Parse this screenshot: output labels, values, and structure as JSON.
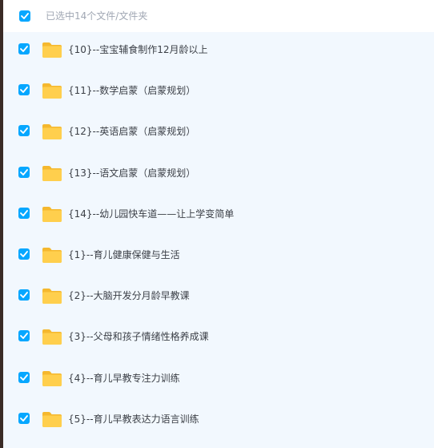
{
  "header": {
    "selection_text": "已选中14个文件/文件夹",
    "checked": true
  },
  "colors": {
    "accent": "#06a7ff",
    "folder": "#ffc94a",
    "background": "#f2f8fe"
  },
  "items": [
    {
      "name": "{10}--宝宝辅食制作12月龄以上",
      "icon": "folder-icon",
      "checked": true
    },
    {
      "name": "{11}--数学启蒙（启蒙规划）",
      "icon": "folder-icon",
      "checked": true
    },
    {
      "name": "{12}--英语启蒙（启蒙规划）",
      "icon": "folder-icon",
      "checked": true
    },
    {
      "name": "{13}--语文启蒙（启蒙规划）",
      "icon": "folder-icon",
      "checked": true
    },
    {
      "name": "{14}--幼儿园快车道——让上学变简单",
      "icon": "folder-icon",
      "checked": true
    },
    {
      "name": "{1}--育儿健康保健与生活",
      "icon": "folder-icon",
      "checked": true
    },
    {
      "name": "{2}--大脑开发分月龄早教课",
      "icon": "folder-icon",
      "checked": true
    },
    {
      "name": "{3}--父母和孩子情绪性格养成课",
      "icon": "folder-icon",
      "checked": true
    },
    {
      "name": "{4}--育儿早教专注力训练",
      "icon": "folder-icon",
      "checked": true
    },
    {
      "name": "{5}--育儿早教表达力语言训练",
      "icon": "folder-icon",
      "checked": true
    }
  ]
}
